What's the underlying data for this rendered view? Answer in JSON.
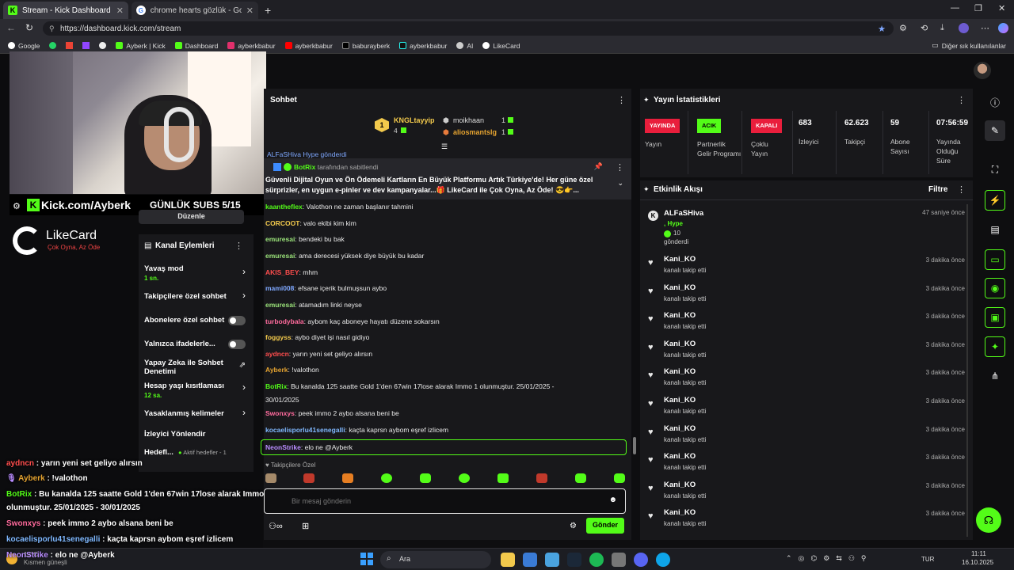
{
  "browser": {
    "tabs": [
      {
        "label": "Stream - Kick Dashboard",
        "active": true
      },
      {
        "label": "chrome hearts gözlük - Google'da",
        "active": false
      }
    ],
    "url": "https://dashboard.kick.com/stream",
    "bookmarks": [
      "Google",
      "Ayberk | Kick",
      "Dashboard",
      "ayberkbabur",
      "ayberkbabur",
      "baburayberk",
      "ayberkbabur",
      "AI",
      "LikeCard"
    ],
    "other_bookmarks": "Diğer sık kullanılanlar"
  },
  "stream_overlay": {
    "kick_url": "Kick.com/Ayberk",
    "subs_goal": "GÜNLÜK SUBS 5/15",
    "likecard_title": "LikeCard",
    "likecard_tagline": "Çok Oyna, Az Öde",
    "duzenle": "Düzenle",
    "chat_lines": [
      {
        "user": "aydncn",
        "text": " : yarın yeni set geliyo alırsın",
        "color": "#ff4d4d"
      },
      {
        "user": "Ayberk",
        "text": " : !valothon",
        "color": "#e5a330"
      },
      {
        "user": "BotRix",
        "text": " : Bu kanalda 125 saatte Gold 1'den 67win 17lose alarak Immo 1",
        "color": "#53fc18"
      },
      {
        "user": "",
        "text": "olunmuştur. 25/01/2025 - 30/01/2025",
        "color": "#fff"
      },
      {
        "user": "Swonxys",
        "text": " : peek immo 2 aybo alsana beni be",
        "color": "#ff6b9d"
      },
      {
        "user": "kocaelisporlu41senegalli",
        "text": " : kaçta kaprsn aybom eşref izlicem",
        "color": "#7fb8ff"
      },
      {
        "user": "NeonStrike",
        "text": " : elo ne @Ayberk",
        "color": "#b98cff"
      }
    ]
  },
  "channel_actions": {
    "title": "Kanal Eylemleri",
    "items": [
      {
        "label": "Yavaş mod",
        "sub": "1 sn.",
        "control": "chevron"
      },
      {
        "label": "Takipçilere özel sohbet",
        "control": "chevron"
      },
      {
        "label": "Abonelere özel sohbet",
        "control": "toggle"
      },
      {
        "label": "Yalnızca ifadelerle...",
        "control": "toggle"
      },
      {
        "label": "Yapay Zeka ile Sohbet Denetimi",
        "control": "external"
      },
      {
        "label": "Hesap yaşı kısıtlaması",
        "sub": "12 sa.",
        "control": "chevron"
      },
      {
        "label": "Yasaklanmış kelimeler",
        "control": "chevron"
      },
      {
        "label": "İzleyici Yönlendir",
        "control": "none"
      },
      {
        "label": "Hedefl...",
        "control": "none",
        "extra": "Aktif hedefler - 1"
      }
    ]
  },
  "chat": {
    "title": "Sohbet",
    "leaderboard": {
      "top_user": "KNGLtayyip",
      "top_count": "4",
      "others": [
        {
          "user": "moikhaan",
          "count": "1"
        },
        {
          "user": "aliosmantslg",
          "count": "1"
        }
      ]
    },
    "hidden_line": "ALFaSHiva Hype gönderdi",
    "pinned": {
      "by": "BotRix",
      "by_suffix": "tarafından sabitlendi",
      "text": "Güvenli Dijital Oyun ve Ön Ödemeli Kartların En Büyük Platformu Artık Türkiye'de! Her güne özel sürprizler, en uygun e-pinler ve dev kampanyalar...🎁 LikeCard ile Çok Oyna, Az Öde! 😎👉..."
    },
    "messages": [
      {
        "user": "kaantheflex",
        "text": ": Valothon ne zaman başlanır tahmini",
        "color": "#53fc18"
      },
      {
        "user": "CORCOOT",
        "text": ": valo ekibi kim kim",
        "color": "#f2c94c"
      },
      {
        "user": "emuresai",
        "text": ": bendeki bu bak",
        "color": "#9be37a"
      },
      {
        "user": "emuresai",
        "text": ": ama derecesi yüksek diye büyük bu kadar",
        "color": "#9be37a"
      },
      {
        "user": "AKIS_BEY",
        "text": ": mhm",
        "color": "#ff4d4d"
      },
      {
        "user": "mami008",
        "text": ": efsane içerik bulmuşsun aybo",
        "color": "#7fa8ff"
      },
      {
        "user": "emuresai",
        "text": ": atamadım linki neyse",
        "color": "#9be37a"
      },
      {
        "user": "turbodybala",
        "text": ": aybom kaç aboneye hayatı düzene sokarsın",
        "color": "#ff6b9d"
      },
      {
        "user": "foggyss",
        "text": ": aybo diyet işi nasıl gidiyo",
        "color": "#f2c94c"
      },
      {
        "user": "aydncn",
        "text": ": yarın yeni set geliyo alırsın",
        "color": "#ff4d4d"
      },
      {
        "user": "Ayberk",
        "text": ": !valothon",
        "color": "#e5a330"
      },
      {
        "user": "BotRix",
        "text": ": Bu kanalda 125 saatte Gold 1'den 67win 17lose alarak Immo 1 olunmuştur. 25/01/2025 -",
        "color": "#53fc18"
      },
      {
        "user": "",
        "text": "30/01/2025",
        "color": "#eaeaea"
      },
      {
        "user": "Swonxys",
        "text": ": peek immo 2 aybo alsana beni be",
        "color": "#ff6b9d"
      },
      {
        "user": "kocaelisporlu41senegalli",
        "text": ": kaçta kaprsn aybom eşref izlicem",
        "color": "#7fb8ff"
      },
      {
        "user": "NeonStrike",
        "text": ": elo ne @Ayberk",
        "color": "#b98cff"
      }
    ],
    "emote_header": "Takipçilere Özel",
    "input_placeholder": "Bir mesaj gönderin",
    "send_label": "Gönder"
  },
  "stats": {
    "title": "Yayın İstatistikleri",
    "items": [
      {
        "badge": "YAYINDA",
        "badge_color": "#e91e3c",
        "label": "Yayın"
      },
      {
        "badge": "ACIK",
        "badge_color": "#53fc18",
        "label": "Partnerlik Gelir Programı"
      },
      {
        "badge": "KAPALI",
        "badge_color": "#e91e3c",
        "label": "Çoklu Yayın"
      },
      {
        "value": "683",
        "label": "İzleyici"
      },
      {
        "value": "62.623",
        "label": "Takipçi"
      },
      {
        "value": "59",
        "label": "Abone Sayısı"
      },
      {
        "value": "07:56:59",
        "label": "Yayında Olduğu Süre"
      }
    ]
  },
  "events": {
    "title": "Etkinlik Akışı",
    "filter_label": "Filtre",
    "items": [
      {
        "user": "ALFaSHiva",
        "line1": ", Hype",
        "line2": "10",
        "line3": "gönderdi",
        "time": "47 saniye önce"
      },
      {
        "user": "Kani_KO",
        "line1": "kanalı takip etti",
        "time": "3 dakika önce"
      },
      {
        "user": "Kani_KO",
        "line1": "kanalı takip etti",
        "time": "3 dakika önce"
      },
      {
        "user": "Kani_KO",
        "line1": "kanalı takip etti",
        "time": "3 dakika önce"
      },
      {
        "user": "Kani_KO",
        "line1": "kanalı takip etti",
        "time": "3 dakika önce"
      },
      {
        "user": "Kani_KO",
        "line1": "kanalı takip etti",
        "time": "3 dakika önce"
      },
      {
        "user": "Kani_KO",
        "line1": "kanalı takip etti",
        "time": "3 dakika önce"
      },
      {
        "user": "Kani_KO",
        "line1": "kanalı takip etti",
        "time": "3 dakika önce"
      },
      {
        "user": "Kani_KO",
        "line1": "kanalı takip etti",
        "time": "3 dakika önce"
      },
      {
        "user": "Kani_KO",
        "line1": "kanalı takip etti",
        "time": "3 dakika önce"
      },
      {
        "user": "Kani_KO",
        "line1": "kanalı takip etti",
        "time": "3 dakika önce"
      }
    ]
  },
  "taskbar": {
    "weather_temp": "13°C",
    "weather_text": "Kısmen güneşli",
    "search": "Ara",
    "lang": "TUR",
    "time": "11:11",
    "date": "16.10.2025"
  },
  "colors": {
    "kick_green": "#53fc18",
    "live_red": "#e91e3c",
    "panel": "#18181b"
  }
}
